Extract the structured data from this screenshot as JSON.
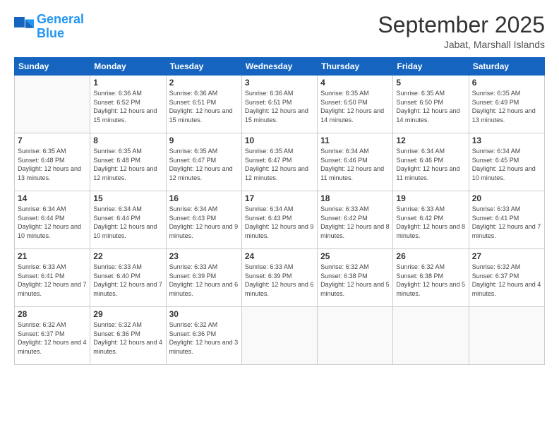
{
  "logo": {
    "line1": "General",
    "line2": "Blue"
  },
  "title": "September 2025",
  "location": "Jabat, Marshall Islands",
  "weekdays": [
    "Sunday",
    "Monday",
    "Tuesday",
    "Wednesday",
    "Thursday",
    "Friday",
    "Saturday"
  ],
  "weeks": [
    [
      {
        "day": "",
        "sunrise": "",
        "sunset": "",
        "daylight": ""
      },
      {
        "day": "1",
        "sunrise": "6:36 AM",
        "sunset": "6:52 PM",
        "daylight": "12 hours and 15 minutes."
      },
      {
        "day": "2",
        "sunrise": "6:36 AM",
        "sunset": "6:51 PM",
        "daylight": "12 hours and 15 minutes."
      },
      {
        "day": "3",
        "sunrise": "6:36 AM",
        "sunset": "6:51 PM",
        "daylight": "12 hours and 15 minutes."
      },
      {
        "day": "4",
        "sunrise": "6:35 AM",
        "sunset": "6:50 PM",
        "daylight": "12 hours and 14 minutes."
      },
      {
        "day": "5",
        "sunrise": "6:35 AM",
        "sunset": "6:50 PM",
        "daylight": "12 hours and 14 minutes."
      },
      {
        "day": "6",
        "sunrise": "6:35 AM",
        "sunset": "6:49 PM",
        "daylight": "12 hours and 13 minutes."
      }
    ],
    [
      {
        "day": "7",
        "sunrise": "6:35 AM",
        "sunset": "6:48 PM",
        "daylight": "12 hours and 13 minutes."
      },
      {
        "day": "8",
        "sunrise": "6:35 AM",
        "sunset": "6:48 PM",
        "daylight": "12 hours and 12 minutes."
      },
      {
        "day": "9",
        "sunrise": "6:35 AM",
        "sunset": "6:47 PM",
        "daylight": "12 hours and 12 minutes."
      },
      {
        "day": "10",
        "sunrise": "6:35 AM",
        "sunset": "6:47 PM",
        "daylight": "12 hours and 12 minutes."
      },
      {
        "day": "11",
        "sunrise": "6:34 AM",
        "sunset": "6:46 PM",
        "daylight": "12 hours and 11 minutes."
      },
      {
        "day": "12",
        "sunrise": "6:34 AM",
        "sunset": "6:46 PM",
        "daylight": "12 hours and 11 minutes."
      },
      {
        "day": "13",
        "sunrise": "6:34 AM",
        "sunset": "6:45 PM",
        "daylight": "12 hours and 10 minutes."
      }
    ],
    [
      {
        "day": "14",
        "sunrise": "6:34 AM",
        "sunset": "6:44 PM",
        "daylight": "12 hours and 10 minutes."
      },
      {
        "day": "15",
        "sunrise": "6:34 AM",
        "sunset": "6:44 PM",
        "daylight": "12 hours and 10 minutes."
      },
      {
        "day": "16",
        "sunrise": "6:34 AM",
        "sunset": "6:43 PM",
        "daylight": "12 hours and 9 minutes."
      },
      {
        "day": "17",
        "sunrise": "6:34 AM",
        "sunset": "6:43 PM",
        "daylight": "12 hours and 9 minutes."
      },
      {
        "day": "18",
        "sunrise": "6:33 AM",
        "sunset": "6:42 PM",
        "daylight": "12 hours and 8 minutes."
      },
      {
        "day": "19",
        "sunrise": "6:33 AM",
        "sunset": "6:42 PM",
        "daylight": "12 hours and 8 minutes."
      },
      {
        "day": "20",
        "sunrise": "6:33 AM",
        "sunset": "6:41 PM",
        "daylight": "12 hours and 7 minutes."
      }
    ],
    [
      {
        "day": "21",
        "sunrise": "6:33 AM",
        "sunset": "6:41 PM",
        "daylight": "12 hours and 7 minutes."
      },
      {
        "day": "22",
        "sunrise": "6:33 AM",
        "sunset": "6:40 PM",
        "daylight": "12 hours and 7 minutes."
      },
      {
        "day": "23",
        "sunrise": "6:33 AM",
        "sunset": "6:39 PM",
        "daylight": "12 hours and 6 minutes."
      },
      {
        "day": "24",
        "sunrise": "6:33 AM",
        "sunset": "6:39 PM",
        "daylight": "12 hours and 6 minutes."
      },
      {
        "day": "25",
        "sunrise": "6:32 AM",
        "sunset": "6:38 PM",
        "daylight": "12 hours and 5 minutes."
      },
      {
        "day": "26",
        "sunrise": "6:32 AM",
        "sunset": "6:38 PM",
        "daylight": "12 hours and 5 minutes."
      },
      {
        "day": "27",
        "sunrise": "6:32 AM",
        "sunset": "6:37 PM",
        "daylight": "12 hours and 4 minutes."
      }
    ],
    [
      {
        "day": "28",
        "sunrise": "6:32 AM",
        "sunset": "6:37 PM",
        "daylight": "12 hours and 4 minutes."
      },
      {
        "day": "29",
        "sunrise": "6:32 AM",
        "sunset": "6:36 PM",
        "daylight": "12 hours and 4 minutes."
      },
      {
        "day": "30",
        "sunrise": "6:32 AM",
        "sunset": "6:36 PM",
        "daylight": "12 hours and 3 minutes."
      },
      {
        "day": "",
        "sunrise": "",
        "sunset": "",
        "daylight": ""
      },
      {
        "day": "",
        "sunrise": "",
        "sunset": "",
        "daylight": ""
      },
      {
        "day": "",
        "sunrise": "",
        "sunset": "",
        "daylight": ""
      },
      {
        "day": "",
        "sunrise": "",
        "sunset": "",
        "daylight": ""
      }
    ]
  ]
}
